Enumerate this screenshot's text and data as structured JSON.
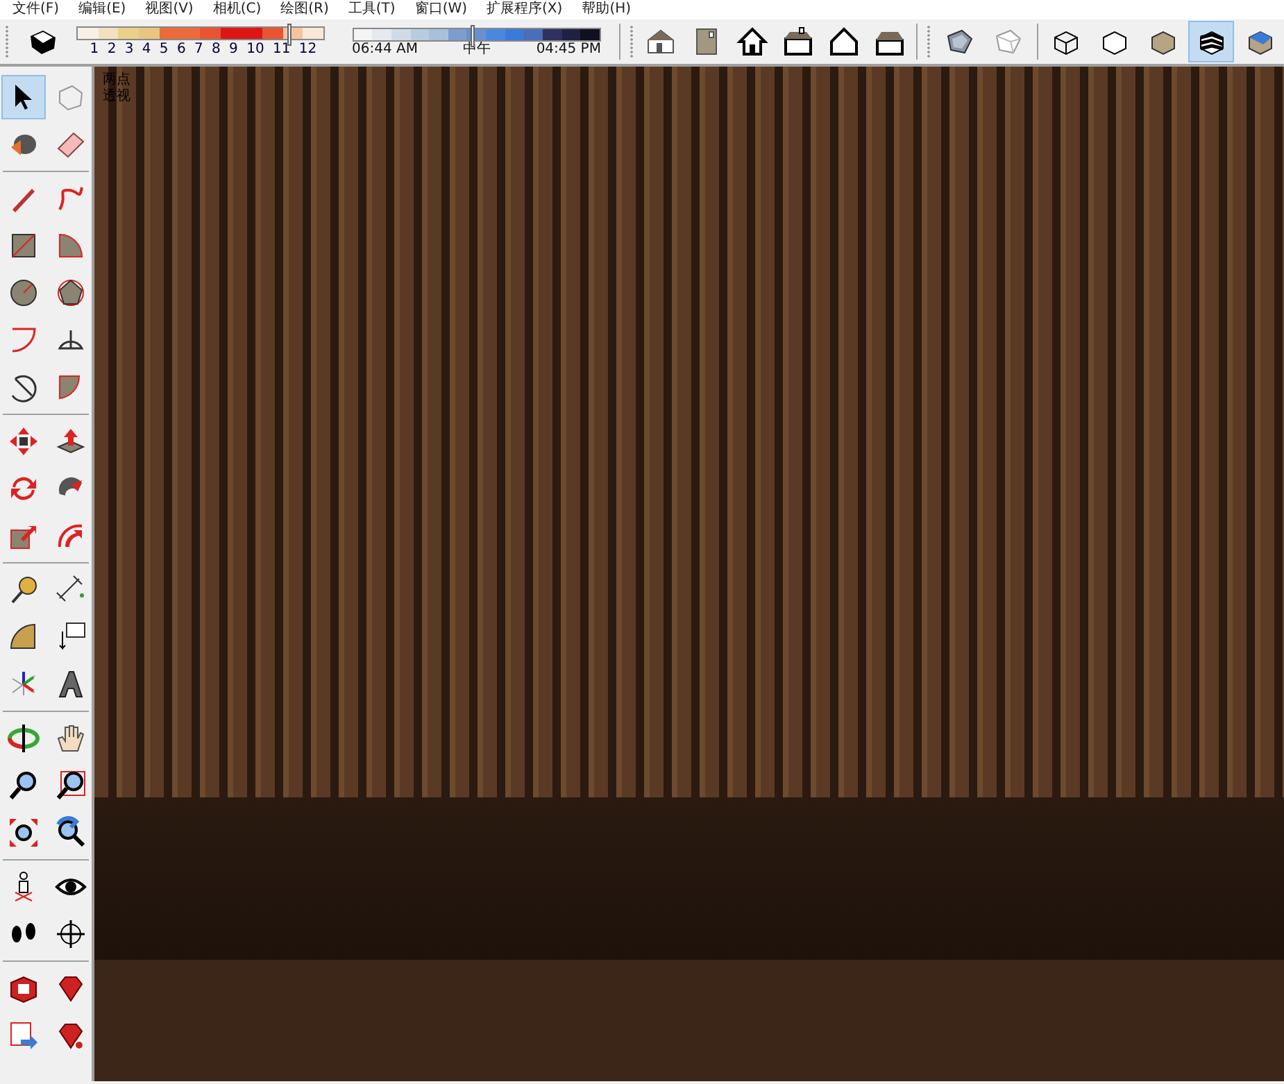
{
  "menu_bar": [
    "文件(F)",
    "编辑(E)",
    "视图(V)",
    "相机(C)",
    "绘图(R)",
    "工具(T)",
    "窗口(W)",
    "扩展程序(X)",
    "帮助(H)"
  ],
  "shadow_toolbar": {
    "month_slider": {
      "labels": [
        "1",
        "2",
        "3",
        "4",
        "5",
        "6",
        "7",
        "8",
        "9",
        "10",
        "11",
        "12"
      ],
      "level": 0.86
    },
    "time_slider": {
      "labels": [
        "06:44 AM",
        "中午",
        "04:45 PM"
      ],
      "level": 0.48
    }
  },
  "views_toolbar": [
    {
      "selected": false
    },
    {
      "selected": false
    },
    {
      "selected": false
    },
    {
      "selected": false
    },
    {
      "selected": false
    },
    {
      "selected": false
    }
  ],
  "styles_toolbar": [
    {
      "selected": false
    },
    {
      "selected": false
    },
    {
      "selected": false
    },
    {
      "selected": false
    },
    {
      "selected": false
    },
    {
      "selected": true
    },
    {
      "selected": false
    }
  ],
  "tools": [
    [
      {
        "selected": true
      },
      {
        "selected": false
      },
      {
        "selected": false
      },
      {
        "selected": false
      }
    ],
    [
      {
        "selected": false
      },
      {
        "selected": false
      },
      {
        "selected": false
      },
      {
        "selected": false
      },
      {
        "selected": false
      },
      {
        "selected": false
      },
      {
        "selected": false
      },
      {
        "selected": false
      },
      {
        "selected": false
      },
      {
        "selected": false
      }
    ],
    [
      {
        "selected": false
      },
      {
        "selected": false
      },
      {
        "selected": false
      },
      {
        "selected": false
      },
      {
        "selected": false
      },
      {
        "selected": false
      }
    ],
    [
      {
        "selected": false
      },
      {
        "selected": false
      },
      {
        "selected": false
      },
      {
        "selected": false
      },
      {
        "selected": false
      },
      {
        "selected": false
      }
    ],
    [
      {
        "selected": false
      },
      {
        "selected": false
      },
      {
        "selected": false
      },
      {
        "selected": false
      },
      {
        "selected": false
      },
      {
        "selected": false
      }
    ],
    [
      {
        "selected": false
      },
      {
        "selected": false
      },
      {
        "selected": false
      },
      {
        "selected": false
      }
    ],
    [
      {
        "selected": false
      },
      {
        "selected": false
      },
      {
        "selected": false
      },
      {
        "selected": false
      }
    ]
  ],
  "viewport": {
    "camera_label": "两点透视"
  }
}
